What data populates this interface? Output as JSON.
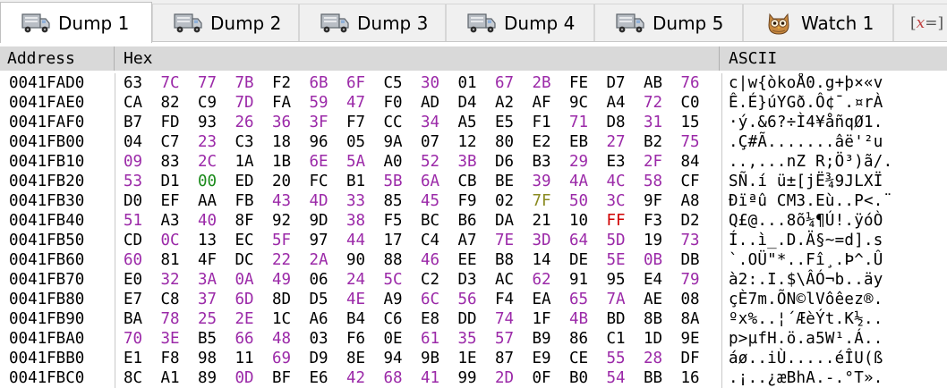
{
  "tabs": [
    {
      "label": "Dump 1",
      "icon": "truck-icon",
      "active": true
    },
    {
      "label": "Dump 2",
      "icon": "truck-icon",
      "active": false
    },
    {
      "label": "Dump 3",
      "icon": "truck-icon",
      "active": false
    },
    {
      "label": "Dump 4",
      "icon": "truck-icon",
      "active": false
    },
    {
      "label": "Dump 5",
      "icon": "truck-icon",
      "active": false
    },
    {
      "label": "Watch 1",
      "icon": "owl-icon",
      "active": false
    },
    {
      "label": "[x=]",
      "icon": "formula-icon",
      "active": false
    }
  ],
  "columns": {
    "address": "Address",
    "hex": "Hex",
    "ascii": "ASCII"
  },
  "colors": {
    "modified_byte": "#9b29a8",
    "zero_byte": "#1a8a1a",
    "ff_byte": "#d00000",
    "alt_byte": "#8a8a20"
  },
  "rows": [
    {
      "address": "0041FAD0",
      "hex": [
        "63",
        "7C",
        "77",
        "7B",
        "F2",
        "6B",
        "6F",
        "C5",
        "30",
        "01",
        "67",
        "2B",
        "FE",
        "D7",
        "AB",
        "76"
      ],
      "ascii": "c|w{òkoÅ0.g+þ×«v"
    },
    {
      "address": "0041FAE0",
      "hex": [
        "CA",
        "82",
        "C9",
        "7D",
        "FA",
        "59",
        "47",
        "F0",
        "AD",
        "D4",
        "A2",
        "AF",
        "9C",
        "A4",
        "72",
        "C0"
      ],
      "ascii": "Ê.É}úYGð.Ô¢¯.¤rÀ"
    },
    {
      "address": "0041FAF0",
      "hex": [
        "B7",
        "FD",
        "93",
        "26",
        "36",
        "3F",
        "F7",
        "CC",
        "34",
        "A5",
        "E5",
        "F1",
        "71",
        "D8",
        "31",
        "15"
      ],
      "ascii": "·ý.&6?÷Ì4¥åñqØ1."
    },
    {
      "address": "0041FB00",
      "hex": [
        "04",
        "C7",
        "23",
        "C3",
        "18",
        "96",
        "05",
        "9A",
        "07",
        "12",
        "80",
        "E2",
        "EB",
        "27",
        "B2",
        "75"
      ],
      "ascii": ".Ç#Ã.......âë'²u"
    },
    {
      "address": "0041FB10",
      "hex": [
        "09",
        "83",
        "2C",
        "1A",
        "1B",
        "6E",
        "5A",
        "A0",
        "52",
        "3B",
        "D6",
        "B3",
        "29",
        "E3",
        "2F",
        "84"
      ],
      "ascii": "..,...nZ R;Ö³)ã/."
    },
    {
      "address": "0041FB20",
      "hex": [
        "53",
        "D1",
        "00",
        "ED",
        "20",
        "FC",
        "B1",
        "5B",
        "6A",
        "CB",
        "BE",
        "39",
        "4A",
        "4C",
        "58",
        "CF"
      ],
      "ascii": "SÑ.í ü±[jË¾9JLXÏ"
    },
    {
      "address": "0041FB30",
      "hex": [
        "D0",
        "EF",
        "AA",
        "FB",
        "43",
        "4D",
        "33",
        "85",
        "45",
        "F9",
        "02",
        "7F",
        "50",
        "3C",
        "9F",
        "A8"
      ],
      "ascii": "Ðïªû CM3.Eù..P<.¨"
    },
    {
      "address": "0041FB40",
      "hex": [
        "51",
        "A3",
        "40",
        "8F",
        "92",
        "9D",
        "38",
        "F5",
        "BC",
        "B6",
        "DA",
        "21",
        "10",
        "FF",
        "F3",
        "D2"
      ],
      "ascii": "Q£@...8õ¼¶Ú!.ÿóÒ"
    },
    {
      "address": "0041FB50",
      "hex": [
        "CD",
        "0C",
        "13",
        "EC",
        "5F",
        "97",
        "44",
        "17",
        "C4",
        "A7",
        "7E",
        "3D",
        "64",
        "5D",
        "19",
        "73"
      ],
      "ascii": "Í..ì_.D.Ä§~=d].s"
    },
    {
      "address": "0041FB60",
      "hex": [
        "60",
        "81",
        "4F",
        "DC",
        "22",
        "2A",
        "90",
        "88",
        "46",
        "EE",
        "B8",
        "14",
        "DE",
        "5E",
        "0B",
        "DB"
      ],
      "ascii": "`.OÜ\"*..Fî¸.Þ^.Û"
    },
    {
      "address": "0041FB70",
      "hex": [
        "E0",
        "32",
        "3A",
        "0A",
        "49",
        "06",
        "24",
        "5C",
        "C2",
        "D3",
        "AC",
        "62",
        "91",
        "95",
        "E4",
        "79"
      ],
      "ascii": "à2:.I.$\\ÂÓ¬b..äy"
    },
    {
      "address": "0041FB80",
      "hex": [
        "E7",
        "C8",
        "37",
        "6D",
        "8D",
        "D5",
        "4E",
        "A9",
        "6C",
        "56",
        "F4",
        "EA",
        "65",
        "7A",
        "AE",
        "08"
      ],
      "ascii": "çÈ7m.ÕN©lVôêez®."
    },
    {
      "address": "0041FB90",
      "hex": [
        "BA",
        "78",
        "25",
        "2E",
        "1C",
        "A6",
        "B4",
        "C6",
        "E8",
        "DD",
        "74",
        "1F",
        "4B",
        "BD",
        "8B",
        "8A"
      ],
      "ascii": "ºx%..¦´ÆèÝt.K½.."
    },
    {
      "address": "0041FBA0",
      "hex": [
        "70",
        "3E",
        "B5",
        "66",
        "48",
        "03",
        "F6",
        "0E",
        "61",
        "35",
        "57",
        "B9",
        "86",
        "C1",
        "1D",
        "9E"
      ],
      "ascii": "p>µfH.ö.a5W¹.Á.."
    },
    {
      "address": "0041FBB0",
      "hex": [
        "E1",
        "F8",
        "98",
        "11",
        "69",
        "D9",
        "8E",
        "94",
        "9B",
        "1E",
        "87",
        "E9",
        "CE",
        "55",
        "28",
        "DF"
      ],
      "ascii": "áø..iÙ.....éÎU(ß"
    },
    {
      "address": "0041FBC0",
      "hex": [
        "8C",
        "A1",
        "89",
        "0D",
        "BF",
        "E6",
        "42",
        "68",
        "41",
        "99",
        "2D",
        "0F",
        "B0",
        "54",
        "BB",
        "16"
      ],
      "ascii": ".¡..¿æBhA.-.°T»."
    }
  ],
  "highlights": {
    "purple": [
      [
        0,
        1
      ],
      [
        0,
        2
      ],
      [
        0,
        3
      ],
      [
        0,
        5
      ],
      [
        0,
        6
      ],
      [
        0,
        8
      ],
      [
        0,
        10
      ],
      [
        0,
        11
      ],
      [
        0,
        15
      ],
      [
        1,
        3
      ],
      [
        1,
        5
      ],
      [
        1,
        6
      ],
      [
        1,
        14
      ],
      [
        2,
        3
      ],
      [
        2,
        4
      ],
      [
        2,
        5
      ],
      [
        2,
        8
      ],
      [
        2,
        12
      ],
      [
        2,
        14
      ],
      [
        3,
        2
      ],
      [
        3,
        13
      ],
      [
        3,
        15
      ],
      [
        4,
        0
      ],
      [
        4,
        2
      ],
      [
        4,
        5
      ],
      [
        4,
        6
      ],
      [
        4,
        8
      ],
      [
        4,
        9
      ],
      [
        4,
        12
      ],
      [
        4,
        14
      ],
      [
        5,
        0
      ],
      [
        5,
        7
      ],
      [
        5,
        8
      ],
      [
        5,
        11
      ],
      [
        5,
        12
      ],
      [
        5,
        13
      ],
      [
        5,
        14
      ],
      [
        6,
        4
      ],
      [
        6,
        5
      ],
      [
        6,
        6
      ],
      [
        6,
        8
      ],
      [
        6,
        12
      ],
      [
        6,
        13
      ],
      [
        7,
        0
      ],
      [
        7,
        2
      ],
      [
        7,
        6
      ],
      [
        8,
        1
      ],
      [
        8,
        4
      ],
      [
        8,
        6
      ],
      [
        8,
        10
      ],
      [
        8,
        11
      ],
      [
        8,
        12
      ],
      [
        8,
        13
      ],
      [
        8,
        15
      ],
      [
        9,
        0
      ],
      [
        9,
        4
      ],
      [
        9,
        5
      ],
      [
        9,
        8
      ],
      [
        9,
        13
      ],
      [
        9,
        14
      ],
      [
        10,
        1
      ],
      [
        10,
        2
      ],
      [
        10,
        3
      ],
      [
        10,
        4
      ],
      [
        10,
        6
      ],
      [
        10,
        7
      ],
      [
        10,
        11
      ],
      [
        10,
        15
      ],
      [
        11,
        2
      ],
      [
        11,
        3
      ],
      [
        11,
        6
      ],
      [
        11,
        8
      ],
      [
        11,
        9
      ],
      [
        11,
        12
      ],
      [
        11,
        13
      ],
      [
        12,
        1
      ],
      [
        12,
        2
      ],
      [
        12,
        3
      ],
      [
        12,
        10
      ],
      [
        12,
        12
      ],
      [
        13,
        0
      ],
      [
        13,
        1
      ],
      [
        13,
        3
      ],
      [
        13,
        4
      ],
      [
        13,
        8
      ],
      [
        13,
        9
      ],
      [
        13,
        10
      ],
      [
        14,
        4
      ],
      [
        14,
        13
      ],
      [
        14,
        14
      ],
      [
        15,
        3
      ],
      [
        15,
        6
      ],
      [
        15,
        7
      ],
      [
        15,
        8
      ],
      [
        15,
        10
      ],
      [
        15,
        13
      ]
    ],
    "green": [
      [
        5,
        2
      ]
    ],
    "olive": [
      [
        6,
        11
      ]
    ],
    "red": [
      [
        7,
        13
      ]
    ]
  }
}
